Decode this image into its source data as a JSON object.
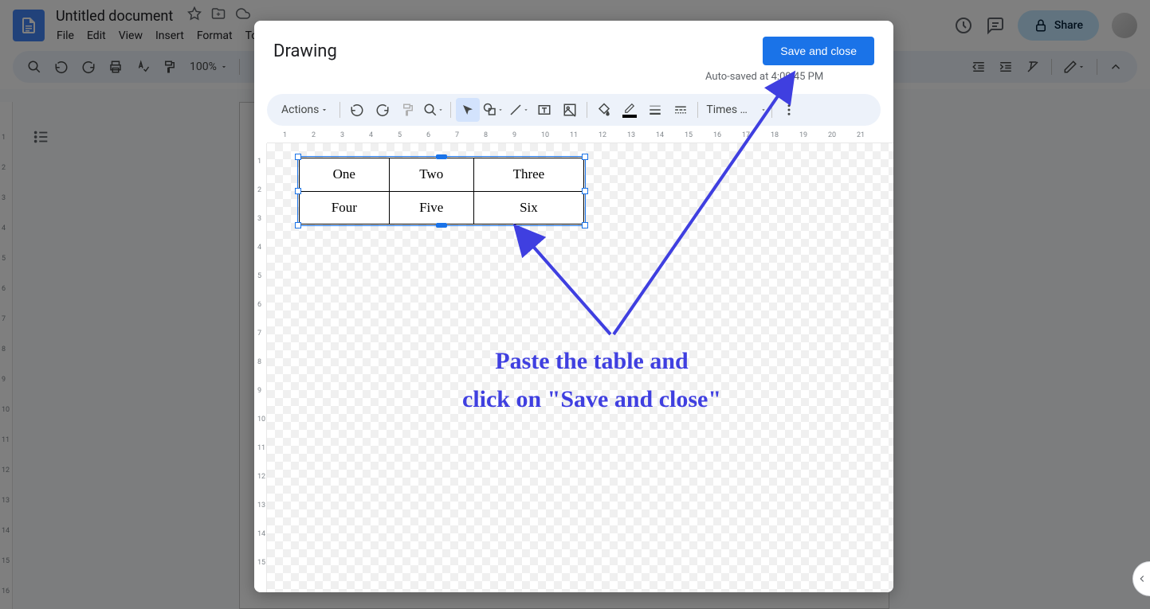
{
  "docs": {
    "title": "Untitled document",
    "menu": {
      "file": "File",
      "edit": "Edit",
      "view": "View",
      "insert": "Insert",
      "format": "Format",
      "tools": "To"
    },
    "zoom": "100%",
    "share": "Share"
  },
  "modal": {
    "title": "Drawing",
    "autosave": "Auto-saved at 4:09:45 PM",
    "save_btn": "Save and close",
    "actions": "Actions",
    "font": "Times …"
  },
  "table": {
    "r1c1": "One",
    "r1c2": "Two",
    "r1c3": "Three",
    "r2c1": "Four",
    "r2c2": "Five",
    "r2c3": "Six"
  },
  "annotation": {
    "line1": "Paste the table and",
    "line2": "click on \"Save and close\""
  },
  "hruler": [
    "1",
    "2",
    "3",
    "4",
    "5",
    "6",
    "7",
    "8",
    "9",
    "10",
    "11",
    "12",
    "13",
    "14",
    "15",
    "16",
    "17",
    "18",
    "19",
    "20",
    "21"
  ],
  "vruler": [
    "1",
    "2",
    "3",
    "4",
    "5",
    "6",
    "7",
    "8",
    "9",
    "10",
    "11",
    "12",
    "13",
    "14",
    "15"
  ],
  "docs_vruler": [
    "1",
    "2",
    "3",
    "4",
    "5",
    "6",
    "7",
    "8",
    "9",
    "10",
    "11",
    "12",
    "13",
    "14",
    "15",
    "16"
  ]
}
